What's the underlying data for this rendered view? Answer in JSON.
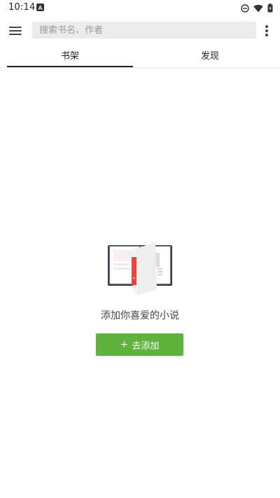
{
  "status_bar": {
    "time": "10:14"
  },
  "search": {
    "placeholder": "搜索书名、作者",
    "value": ""
  },
  "tabs": [
    {
      "label": "书架",
      "active": true
    },
    {
      "label": "发现",
      "active": false
    }
  ],
  "empty_state": {
    "message": "添加你喜爱的小说",
    "button_label": "去添加",
    "button_icon": "+"
  },
  "icons": {
    "menu": "hamburger-menu-icon",
    "more": "more-vertical-icon",
    "status": [
      "a-notification-icon",
      "do-not-disturb-icon",
      "wifi-icon",
      "battery-icon"
    ],
    "illustration": "open-book-icon"
  },
  "colors": {
    "accent": "#5fb23b",
    "bookmark": "#e8453c",
    "search_bg": "#ececec",
    "text": "#222222"
  }
}
